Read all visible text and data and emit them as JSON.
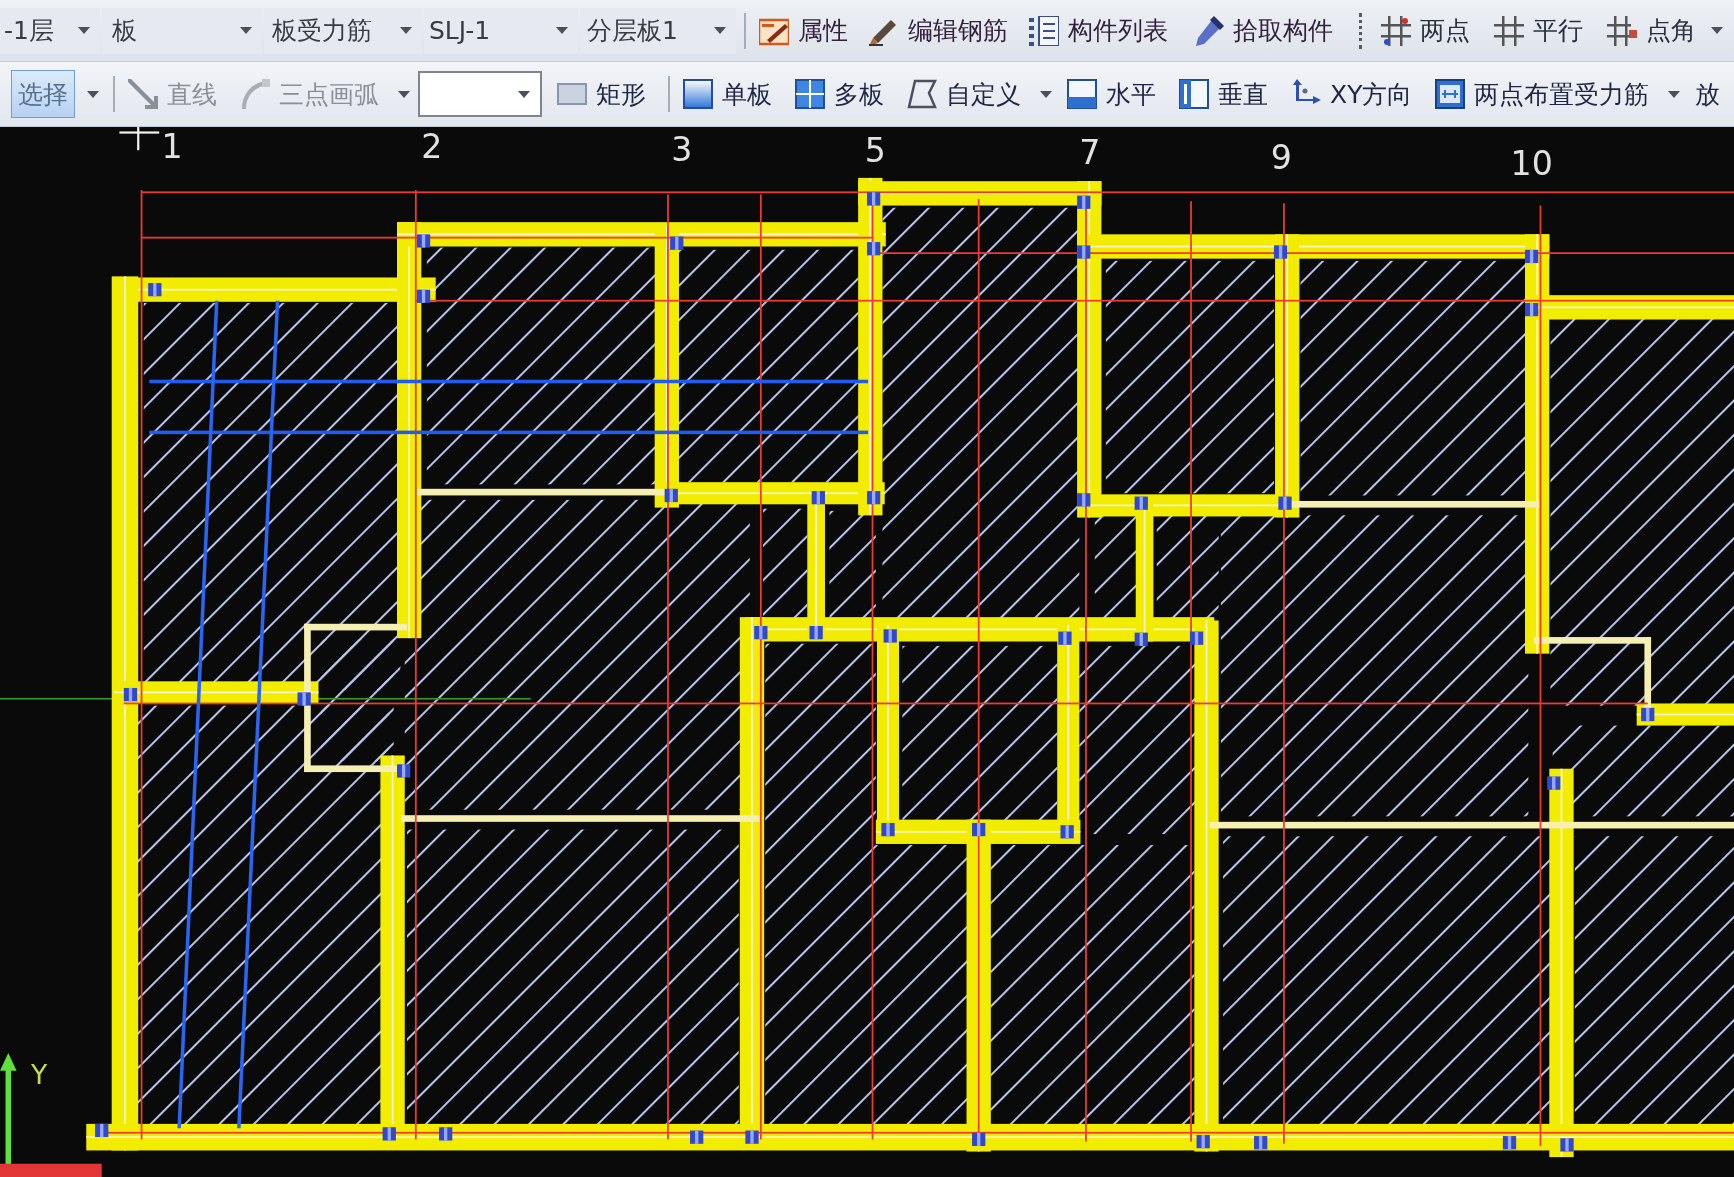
{
  "floor_toolbar": {
    "dropdowns": [
      {
        "value": "-1层"
      },
      {
        "value": "板"
      },
      {
        "value": "板受力筋"
      },
      {
        "value": "SLJ-1"
      },
      {
        "value": "分层板1"
      }
    ],
    "buttons": [
      {
        "label": "属性"
      },
      {
        "label": "编辑钢筋"
      },
      {
        "label": "构件列表"
      },
      {
        "label": "拾取构件"
      }
    ],
    "axis_tools": [
      {
        "label": "两点"
      },
      {
        "label": "平行"
      },
      {
        "label": "点角",
        "dropdown": true
      }
    ]
  },
  "draw_toolbar": {
    "groups": [
      [
        {
          "kind": "tool",
          "label": "选择",
          "selected": true,
          "disabled": false,
          "dropdown": true
        }
      ],
      [
        {
          "kind": "tool",
          "label": "直线",
          "selected": false,
          "disabled": true
        },
        {
          "kind": "tool",
          "label": "三点画弧",
          "selected": false,
          "disabled": true,
          "dropdown": true
        },
        {
          "kind": "combo"
        },
        {
          "kind": "tool",
          "label": "矩形",
          "selected": false,
          "disabled": false
        }
      ],
      [
        {
          "kind": "tool",
          "label": "单板",
          "selected": false,
          "disabled": false
        },
        {
          "kind": "tool",
          "label": "多板",
          "selected": false,
          "disabled": false
        },
        {
          "kind": "tool",
          "label": "自定义",
          "selected": false,
          "disabled": false,
          "dropdown": true
        },
        {
          "kind": "tool",
          "label": "水平",
          "selected": false,
          "disabled": false
        },
        {
          "kind": "tool",
          "label": "垂直",
          "selected": false,
          "disabled": false
        },
        {
          "kind": "tool",
          "label": "XY方向",
          "selected": false,
          "disabled": false
        },
        {
          "kind": "tool",
          "label": "两点布置受力筋",
          "selected": false,
          "disabled": false,
          "dropdown": true
        },
        {
          "kind": "tool",
          "label": "放",
          "selected": false,
          "disabled": false
        }
      ]
    ]
  },
  "canvas": {
    "axis_labels": [
      {
        "label": "1"
      },
      {
        "label": "2"
      },
      {
        "label": "3"
      },
      {
        "label": "5"
      },
      {
        "label": "7"
      },
      {
        "label": "9"
      },
      {
        "label": "10"
      }
    ],
    "ucs": {
      "y_label": "Y"
    }
  }
}
